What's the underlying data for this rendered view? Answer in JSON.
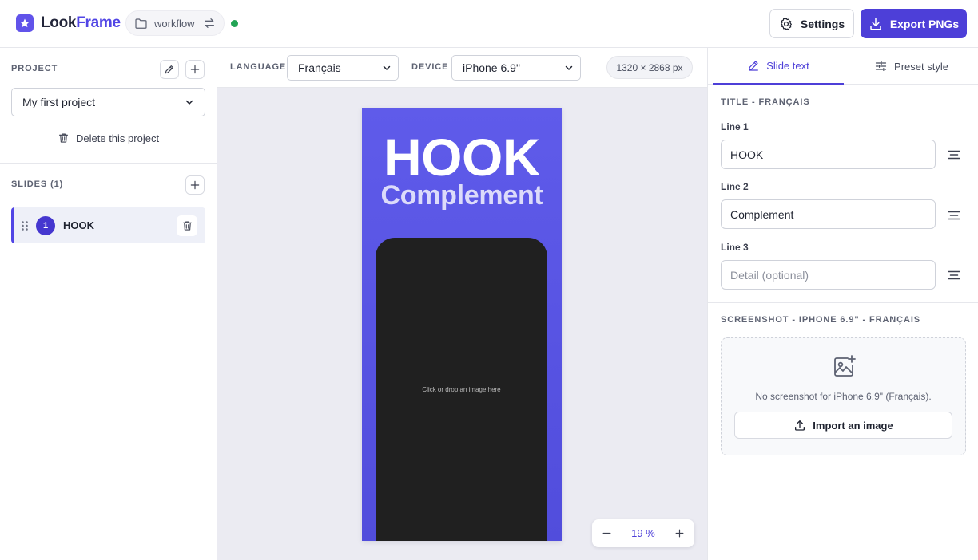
{
  "app": {
    "name_prefix": "Look",
    "name_suffix": "Frame",
    "logo_icon": "star-icon",
    "workspace_label": "workflow",
    "status_color": "#22a455"
  },
  "header": {
    "settings_label": "Settings",
    "export_label": "Export PNGs",
    "accent_color": "#4d3fd8"
  },
  "sidebar": {
    "project_label": "PROJECT",
    "project_selected": "My first project",
    "delete_project_label": "Delete this project",
    "slides_label": "SLIDES (1)",
    "slides": [
      {
        "number": "1",
        "name": "HOOK"
      }
    ]
  },
  "toolbar": {
    "language_label": "LANGUAGE",
    "language_value": "Français",
    "device_label": "DEVICE",
    "device_value": "iPhone 6.9\"",
    "dimensions": "1320 × 2868 px"
  },
  "canvas": {
    "title": "HOOK",
    "subtitle": "Complement",
    "screenshot_hint": "Click or drop an image here",
    "background_color": "#5f5bea"
  },
  "zoom": {
    "value": "19 %"
  },
  "rpanel": {
    "tabs": [
      {
        "label": "Slide text",
        "icon": "pencil-icon",
        "active": true
      },
      {
        "label": "Preset style",
        "icon": "sliders-icon",
        "active": false
      }
    ],
    "title_section": "TITLE - FRANÇAIS",
    "lines": [
      {
        "label": "Line 1",
        "value": "HOOK",
        "placeholder": ""
      },
      {
        "label": "Line 2",
        "value": "Complement",
        "placeholder": ""
      },
      {
        "label": "Line 3",
        "value": "",
        "placeholder": "Detail (optional)"
      }
    ],
    "screenshot_section": "SCREENSHOT - IPHONE 6.9\" - FRANÇAIS",
    "no_screenshot": "No screenshot for iPhone 6.9\" (Français).",
    "import_label": "Import an image"
  }
}
